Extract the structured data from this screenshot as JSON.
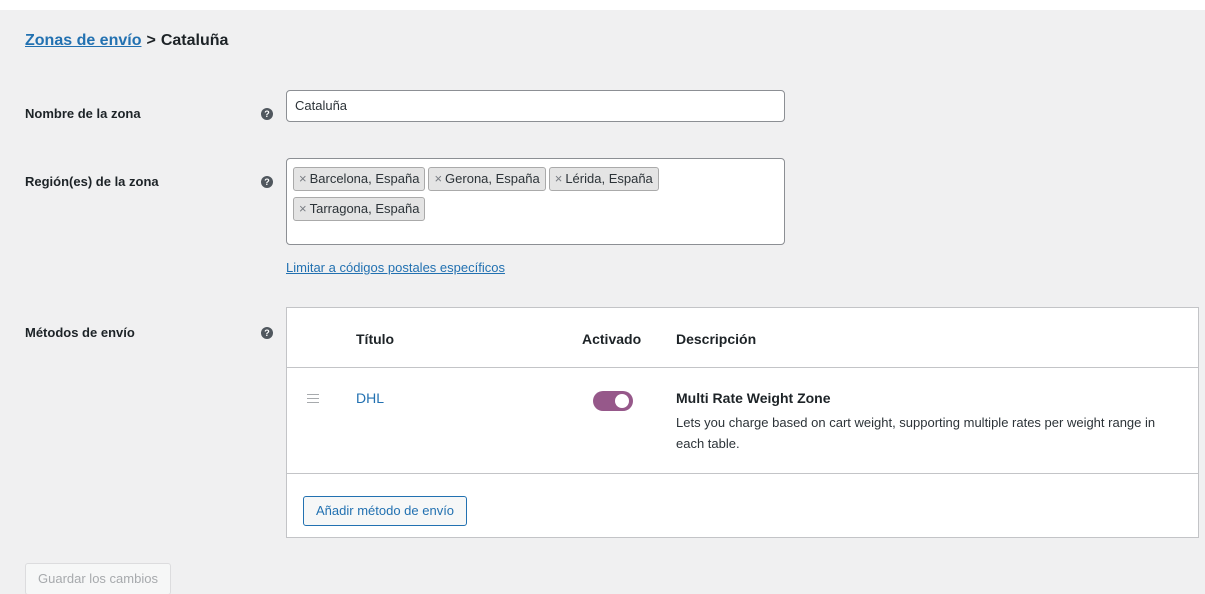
{
  "breadcrumb": {
    "parent": "Zonas de envío",
    "separator": ">",
    "current": "Cataluña"
  },
  "zone_name": {
    "label": "Nombre de la zona",
    "help_icon": "help-icon",
    "value": "Cataluña"
  },
  "zone_regions": {
    "label": "Región(es) de la zona",
    "help_icon": "help-icon",
    "remove_symbol": "×",
    "chips": [
      "Barcelona, España",
      "Gerona, España",
      "Lérida, España",
      "Tarragona, España"
    ],
    "postal_link": "Limitar a códigos postales específicos"
  },
  "shipping_methods": {
    "label": "Métodos de envío",
    "help_icon": "help-icon",
    "columns": {
      "title": "Título",
      "enabled": "Activado",
      "description": "Descripción"
    },
    "rows": [
      {
        "title": "DHL",
        "enabled": true,
        "description_title": "Multi Rate Weight Zone",
        "description": "Lets you charge based on cart weight, supporting multiple rates per weight range in each table."
      }
    ],
    "add_button": "Añadir método de envío"
  },
  "save_button": "Guardar los cambios",
  "colors": {
    "link": "#2271b1",
    "toggle_on": "#96588a",
    "background": "#f0f0f1"
  }
}
